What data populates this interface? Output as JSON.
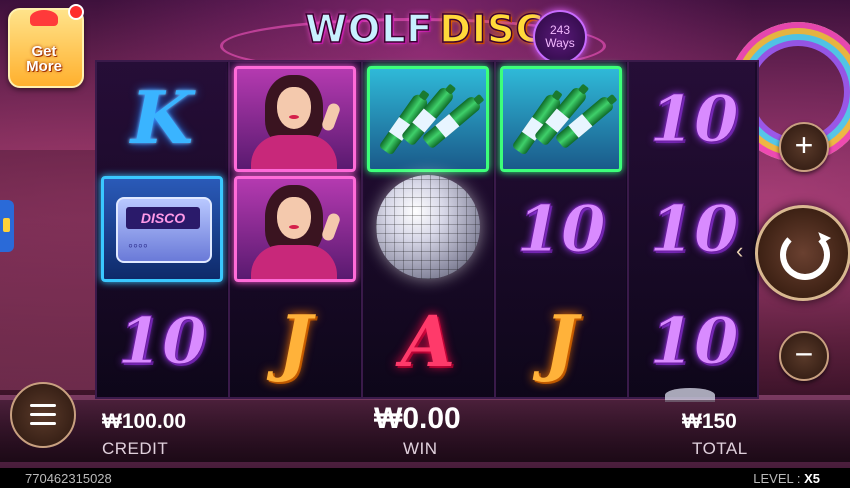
{
  "game": {
    "title_part1": "WOLF",
    "title_part2": "DISCO",
    "ways_count": "243",
    "ways_label": "Ways"
  },
  "promo": {
    "label_line1": "Get",
    "label_line2": "More"
  },
  "reels": [
    [
      "K",
      "pager",
      "10"
    ],
    [
      "singer",
      "singer",
      "J"
    ],
    [
      "bottles",
      "disco_ball",
      "A"
    ],
    [
      "bottles",
      "10",
      "J"
    ],
    [
      "10",
      "10",
      "10"
    ]
  ],
  "symbols": {
    "ten": "10",
    "K": "K",
    "J": "J",
    "A": "A",
    "pager_screen": "DISCO"
  },
  "controls": {
    "plus": "+",
    "minus": "−",
    "spin_chevron": "‹"
  },
  "stats": {
    "credit_value": "₩100.00",
    "credit_label": "CREDIT",
    "win_value": "₩0.00",
    "win_label": "WIN",
    "total_value": "₩150",
    "total_label": "TOTAL"
  },
  "status": {
    "round_id": "770462315028",
    "level_label": "LEVEL :",
    "level_value": "X5"
  },
  "colors": {
    "accent_pink": "#ff6bd8",
    "accent_gold": "#ffd93a",
    "accent_purple": "#d98bff"
  }
}
